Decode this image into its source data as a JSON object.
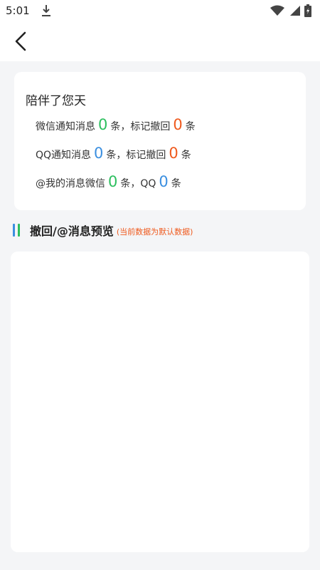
{
  "status_bar": {
    "time": "5:01",
    "icons": [
      "download-icon",
      "wifi-icon",
      "signal-icon",
      "battery-icon"
    ]
  },
  "header": {
    "back_icon": "chevron-left-icon"
  },
  "summary": {
    "title": "陪伴了您天",
    "wechat_line": {
      "label": "微信通知消息",
      "count": "0",
      "unit": "条，标记撤回",
      "recall_count": "0",
      "unit2": "条"
    },
    "qq_line": {
      "label": "QQ通知消息",
      "count": "0",
      "unit": "条，标记撤回",
      "recall_count": "0",
      "unit2": "条"
    },
    "at_line": {
      "label": "@我的消息微信",
      "wechat_count": "0",
      "unit": "条，QQ",
      "qq_count": "0",
      "unit2": "条"
    }
  },
  "preview": {
    "title": "撤回/@消息预览",
    "note": "(当前数据为默认数据)"
  },
  "colors": {
    "green": "#2dbf5f",
    "orange": "#ef5a1e",
    "blue": "#3b8fe0",
    "background": "#f4f5f7"
  }
}
